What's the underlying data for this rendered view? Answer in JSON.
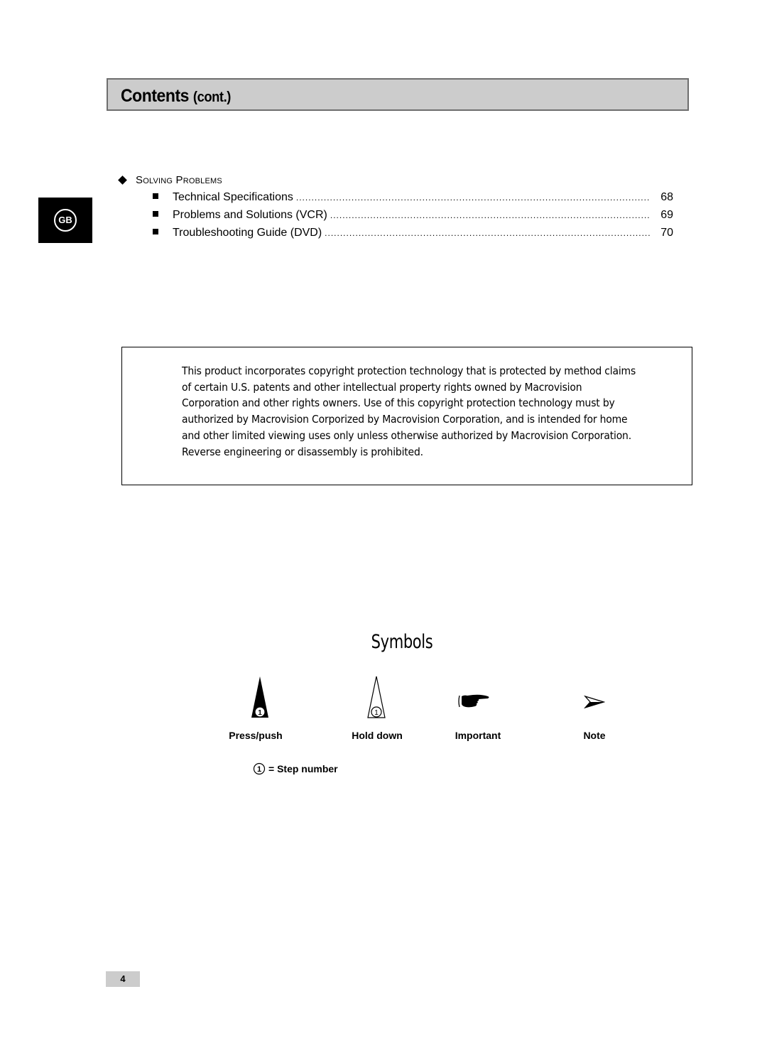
{
  "header": {
    "title": "Contents",
    "subtitle": "(cont.)"
  },
  "language_tab": {
    "label": "GB"
  },
  "section": {
    "title": "Solving Problems",
    "icon": "diamond-bullet-icon",
    "items": [
      {
        "label": "Technical Specifications",
        "page": "68"
      },
      {
        "label": "Problems and Solutions (VCR)",
        "page": "69"
      },
      {
        "label": "Troubleshooting Guide (DVD)",
        "page": "70"
      }
    ]
  },
  "notice": {
    "text": "This product incorporates copyright protection technology that is protected by method claims of certain U.S. patents and other intellectual property rights owned by Macrovision Corporation and other rights owners. Use of this copyright protection technology must by authorized by Macrovision Corporized by Macrovision Corporation, and is intended for home and other limited viewing uses only unless otherwise authorized by Macrovision Corporation. Reverse engineering or disassembly is prohibited."
  },
  "symbols": {
    "title": "Symbols",
    "items": [
      {
        "icon": "press-push-icon",
        "label": "Press/push",
        "step": "1"
      },
      {
        "icon": "hold-down-icon",
        "label": "Hold down",
        "step": "1"
      },
      {
        "icon": "pointing-hand-icon",
        "label": "Important"
      },
      {
        "icon": "arrowhead-icon",
        "label": "Note"
      }
    ],
    "legend": {
      "step": "1",
      "text": "= Step number"
    }
  },
  "footer": {
    "page_number": "4"
  }
}
